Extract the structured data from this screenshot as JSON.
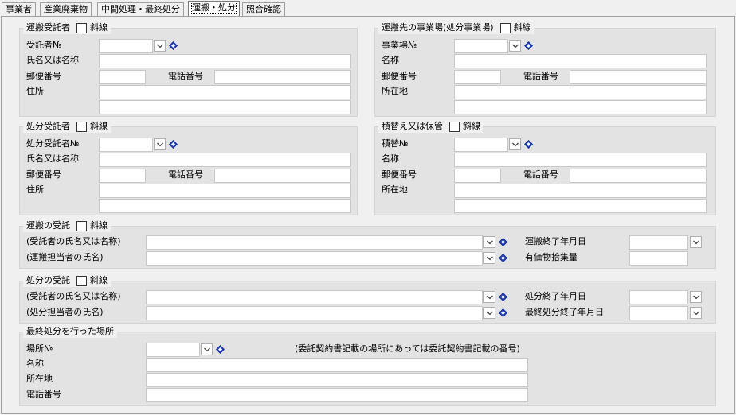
{
  "tabs": [
    "事業者",
    "産業廃棄物",
    "中間処理・最終処分",
    "運搬・処分",
    "照合確認"
  ],
  "active_tab": 3,
  "common": {
    "strike": "斜線"
  },
  "carrier": {
    "title": "運搬受託者",
    "no_label": "受託者№",
    "name_label": "氏名又は名称",
    "zip_label": "郵便番号",
    "tel_label": "電話番号",
    "addr_label": "住所"
  },
  "destination": {
    "title": "運搬先の事業場(処分事業場)",
    "no_label": "事業場№",
    "name_label": "名称",
    "zip_label": "郵便番号",
    "tel_label": "電話番号",
    "addr_label": "所在地"
  },
  "disposer": {
    "title": "処分受託者",
    "no_label": "処分受託者№",
    "name_label": "氏名又は名称",
    "zip_label": "郵便番号",
    "tel_label": "電話番号",
    "addr_label": "住所"
  },
  "transship": {
    "title": "積替え又は保管",
    "no_label": "積替№",
    "name_label": "名称",
    "zip_label": "郵便番号",
    "tel_label": "電話番号",
    "addr_label": "所在地"
  },
  "transport_receipt": {
    "title": "運搬の受託",
    "name_label": "(受託者の氏名又は名称)",
    "staff_label": "(運搬担当者の氏名)",
    "end_date_label": "運搬終了年月日",
    "valuables_label": "有価物拾集量"
  },
  "disposal_receipt": {
    "title": "処分の受託",
    "name_label": "(受託者の氏名又は名称)",
    "staff_label": "(処分担当者の氏名)",
    "end_date_label": "処分終了年月日",
    "final_end_date_label": "最終処分終了年月日"
  },
  "final_site": {
    "title": "最終処分を行った場所",
    "no_label": "場所№",
    "note": "(委託契約書記載の場所にあっては委託契約書記載の番号)",
    "name_label": "名称",
    "addr_label": "所在地",
    "tel_label": "電話番号"
  }
}
